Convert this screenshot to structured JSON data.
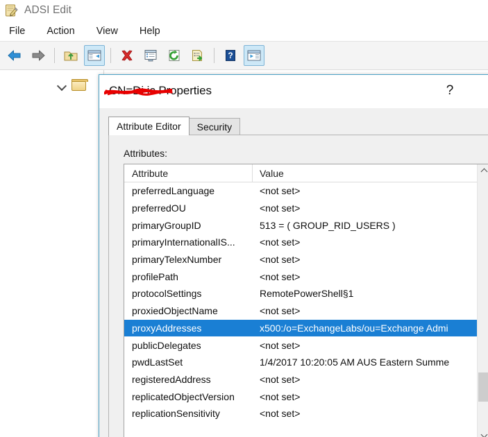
{
  "app": {
    "title": "ADSI Edit",
    "icon": "adsi-edit-icon"
  },
  "menubar": {
    "items": [
      {
        "label": "File",
        "name": "menu-file"
      },
      {
        "label": "Action",
        "name": "menu-action"
      },
      {
        "label": "View",
        "name": "menu-view"
      },
      {
        "label": "Help",
        "name": "menu-help"
      }
    ]
  },
  "toolbar": {
    "buttons": [
      {
        "icon": "back-arrow-icon",
        "active": false
      },
      {
        "icon": "forward-arrow-icon",
        "active": false
      },
      {
        "icon": "up-folder-icon",
        "active": false
      },
      {
        "icon": "show-hide-tree-icon",
        "active": true
      },
      {
        "icon": "delete-x-icon",
        "active": false
      },
      {
        "icon": "properties-icon",
        "active": false
      },
      {
        "icon": "refresh-icon",
        "active": false
      },
      {
        "icon": "export-list-icon",
        "active": false
      },
      {
        "icon": "help-icon",
        "active": false
      },
      {
        "icon": "show-console-tree-icon",
        "active": true
      }
    ]
  },
  "tree": {
    "expander": "chevron-down-icon",
    "node_icon": "folder-icon"
  },
  "dialog": {
    "title": "CN=Di            ic Properties",
    "title_prefix": "CN=",
    "title_suffix": " Properties",
    "redacted_name": "Di████████ic",
    "help_label": "?",
    "close_label": "✕",
    "redaction_color": "#e80000",
    "tabs": [
      {
        "label": "Attribute Editor",
        "selected": true
      },
      {
        "label": "Security",
        "selected": false
      }
    ],
    "attributes_label": "Attributes:",
    "columns": [
      "Attribute",
      "Value"
    ],
    "selection_color": "#1a7fd4",
    "rows": [
      {
        "attribute": "preferredLanguage",
        "value": "<not set>",
        "selected": false
      },
      {
        "attribute": "preferredOU",
        "value": "<not set>",
        "selected": false
      },
      {
        "attribute": "primaryGroupID",
        "value": "513 = ( GROUP_RID_USERS )",
        "selected": false
      },
      {
        "attribute": "primaryInternationalIS...",
        "value": "<not set>",
        "selected": false
      },
      {
        "attribute": "primaryTelexNumber",
        "value": "<not set>",
        "selected": false
      },
      {
        "attribute": "profilePath",
        "value": "<not set>",
        "selected": false
      },
      {
        "attribute": "protocolSettings",
        "value": "RemotePowerShell§1",
        "selected": false
      },
      {
        "attribute": "proxiedObjectName",
        "value": "<not set>",
        "selected": false
      },
      {
        "attribute": "proxyAddresses",
        "value": "x500:/o=ExchangeLabs/ou=Exchange Admi",
        "selected": true
      },
      {
        "attribute": "publicDelegates",
        "value": "<not set>",
        "selected": false
      },
      {
        "attribute": "pwdLastSet",
        "value": "1/4/2017 10:20:05 AM AUS Eastern Summe",
        "selected": false
      },
      {
        "attribute": "registeredAddress",
        "value": "<not set>",
        "selected": false
      },
      {
        "attribute": "replicatedObjectVersion",
        "value": "<not set>",
        "selected": false
      },
      {
        "attribute": "replicationSensitivity",
        "value": "<not set>",
        "selected": false
      }
    ],
    "scrollbar": {
      "up_icon": "scroll-up-arrow-icon",
      "down_icon": "scroll-down-arrow-icon"
    }
  }
}
